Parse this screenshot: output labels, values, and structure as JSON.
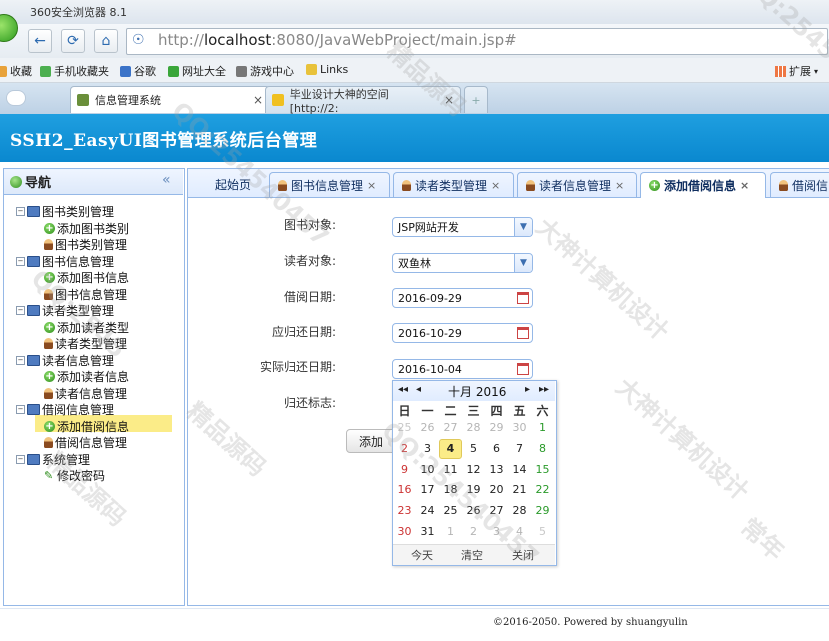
{
  "browser": {
    "window_title": "360安全浏览器 8.1",
    "url_prefix": "http://",
    "url_host": "localhost",
    "url_rest": ":8080/JavaWebProject/main.jsp#",
    "favorites": [
      {
        "label": "收藏",
        "color": "#e8a23a"
      },
      {
        "label": "手机收藏夹",
        "color": "#4caf50"
      },
      {
        "label": "谷歌",
        "color": "#3b73c8"
      },
      {
        "label": "网址大全",
        "color": "#3aa63a"
      },
      {
        "label": "游戏中心",
        "color": "#777777"
      },
      {
        "label": "Links",
        "color": "#e8c23a"
      }
    ],
    "extensions_label": "扩展",
    "tabs": [
      {
        "label": "信息管理系统",
        "active": true
      },
      {
        "label": "毕业设计大神的空间 [http://2:",
        "active": false
      }
    ],
    "new_tab_label": "+"
  },
  "app": {
    "title": "SSH2_EasyUI图书管理系统后台管理",
    "sidebar": {
      "title": "导航",
      "collapse_label": "«",
      "tree": [
        {
          "label": "图书类别管理",
          "children": [
            "添加图书类别",
            "图书类别管理"
          ]
        },
        {
          "label": "图书信息管理",
          "children": [
            "添加图书信息",
            "图书信息管理"
          ]
        },
        {
          "label": "读者类型管理",
          "children": [
            "添加读者类型",
            "读者类型管理"
          ]
        },
        {
          "label": "读者信息管理",
          "children": [
            "添加读者信息",
            "读者信息管理"
          ]
        },
        {
          "label": "借阅信息管理",
          "children": [
            "添加借阅信息",
            "借阅信息管理"
          ]
        },
        {
          "label": "系统管理",
          "children": [
            "修改密码"
          ]
        }
      ],
      "selected": "添加借阅信息"
    },
    "tabs": [
      "起始页",
      "图书信息管理",
      "读者类型管理",
      "读者信息管理",
      "添加借阅信息",
      "借阅信"
    ],
    "active_tab": "添加借阅信息",
    "form": {
      "book_label": "图书对象:",
      "book_value": "JSP网站开发",
      "reader_label": "读者对象:",
      "reader_value": "双鱼林",
      "borrow_date_label": "借阅日期:",
      "borrow_date_value": "2016-09-29",
      "due_date_label": "应归还日期:",
      "due_date_value": "2016-10-29",
      "return_date_label": "实际归还日期:",
      "return_date_value": "2016-10-04",
      "return_flag_label": "归还标志:",
      "submit_label": "添加"
    },
    "calendar": {
      "nav_prev_year": "◂◂",
      "nav_prev_month": "◂",
      "nav_next_month": "▸",
      "nav_next_year": "▸▸",
      "month_label": "十月 2016",
      "weekdays": [
        "日",
        "一",
        "二",
        "三",
        "四",
        "五",
        "六"
      ],
      "weeks": [
        [
          "25",
          "26",
          "27",
          "28",
          "29",
          "30",
          "1"
        ],
        [
          "2",
          "3",
          "4",
          "5",
          "6",
          "7",
          "8"
        ],
        [
          "9",
          "10",
          "11",
          "12",
          "13",
          "14",
          "15"
        ],
        [
          "16",
          "17",
          "18",
          "19",
          "20",
          "21",
          "22"
        ],
        [
          "23",
          "24",
          "25",
          "26",
          "27",
          "28",
          "29"
        ],
        [
          "30",
          "31",
          "1",
          "2",
          "3",
          "4",
          "5"
        ]
      ],
      "selected_day": "4",
      "today_label": "今天",
      "clear_label": "清空",
      "close_label": "关闭"
    },
    "footer": "©2016-2050. Powered by shuangyulin"
  },
  "watermarks": [
    "精品源码",
    "QQ:254540457",
    "大神计算机设计",
    "QQ:2545",
    "精品源码",
    "QQ:254540457",
    "大神计算机设计",
    "QQ:254540457",
    "精品源码",
    "常年"
  ]
}
